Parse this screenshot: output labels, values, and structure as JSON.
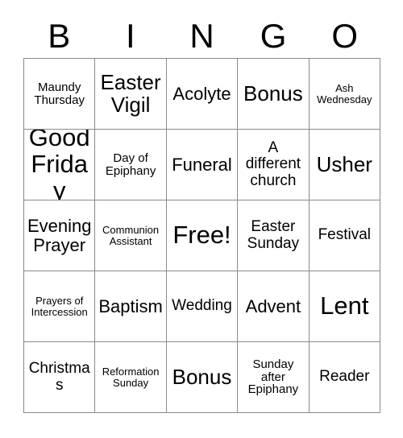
{
  "header": {
    "letters": [
      "B",
      "I",
      "N",
      "G",
      "O"
    ]
  },
  "grid": {
    "rows": [
      [
        {
          "text": "Maundy Thursday",
          "size": "sm"
        },
        {
          "text": "Easter Vigil",
          "size": "xl"
        },
        {
          "text": "Acolyte",
          "size": "lg"
        },
        {
          "text": "Bonus",
          "size": "xl"
        },
        {
          "text": "Ash Wednesday",
          "size": "xs"
        }
      ],
      [
        {
          "text": "Good Friday",
          "size": "xxl"
        },
        {
          "text": "Day of Epiphany",
          "size": "sm"
        },
        {
          "text": "Funeral",
          "size": "lg"
        },
        {
          "text": "A different church",
          "size": "md"
        },
        {
          "text": "Usher",
          "size": "xl"
        }
      ],
      [
        {
          "text": "Evening Prayer",
          "size": "lg"
        },
        {
          "text": "Communion Assistant",
          "size": "xs"
        },
        {
          "text": "Free!",
          "size": "xxl"
        },
        {
          "text": "Easter Sunday",
          "size": "md"
        },
        {
          "text": "Festival",
          "size": "md"
        }
      ],
      [
        {
          "text": "Prayers of Intercession",
          "size": "xs"
        },
        {
          "text": "Baptism",
          "size": "lg"
        },
        {
          "text": "Wedding",
          "size": "md"
        },
        {
          "text": "Advent",
          "size": "lg"
        },
        {
          "text": "Lent",
          "size": "xxl"
        }
      ],
      [
        {
          "text": "Christmas",
          "size": "md"
        },
        {
          "text": "Reformation Sunday",
          "size": "xs"
        },
        {
          "text": "Bonus",
          "size": "xl"
        },
        {
          "text": "Sunday after Epiphany",
          "size": "sm"
        },
        {
          "text": "Reader",
          "size": "md"
        }
      ]
    ],
    "free_space": {
      "row": 2,
      "col": 2,
      "label": "Free!"
    }
  },
  "colors": {
    "background": "#ffffff",
    "text": "#000000",
    "grid_line": "#8a8a8a"
  }
}
